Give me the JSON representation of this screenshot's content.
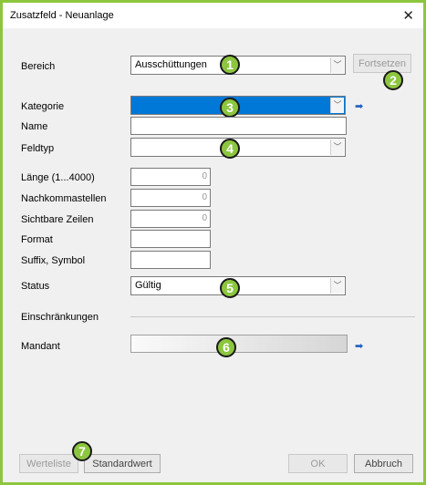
{
  "window": {
    "title": "Zusatzfeld - Neuanlage",
    "close": "✕"
  },
  "fields": {
    "bereich": {
      "label": "Bereich",
      "value": "Ausschüttungen"
    },
    "fortsetzen": "Fortsetzen",
    "kategorie": {
      "label": "Kategorie"
    },
    "name": {
      "label": "Name"
    },
    "feldtyp": {
      "label": "Feldtyp"
    },
    "laenge": {
      "label": "Länge (1...4000)",
      "value": "0"
    },
    "nachkomma": {
      "label": "Nachkommastellen",
      "value": "0"
    },
    "zeilen": {
      "label": "Sichtbare Zeilen",
      "value": "0"
    },
    "format": {
      "label": "Format"
    },
    "suffix": {
      "label": "Suffix, Symbol"
    },
    "status": {
      "label": "Status",
      "value": "Gültig"
    },
    "einschraenkungen": {
      "label": "Einschränkungen"
    },
    "mandant": {
      "label": "Mandant"
    }
  },
  "buttons": {
    "werteliste": "Werteliste",
    "standardwert": "Standardwert",
    "ok": "OK",
    "abbruch": "Abbruch"
  },
  "badges": [
    "1",
    "2",
    "3",
    "4",
    "5",
    "6",
    "7"
  ],
  "icons": {
    "dropdown": "﹀",
    "pin": "➡"
  },
  "colors": {
    "accent": "#8cc63f",
    "selection": "#0078d7"
  }
}
